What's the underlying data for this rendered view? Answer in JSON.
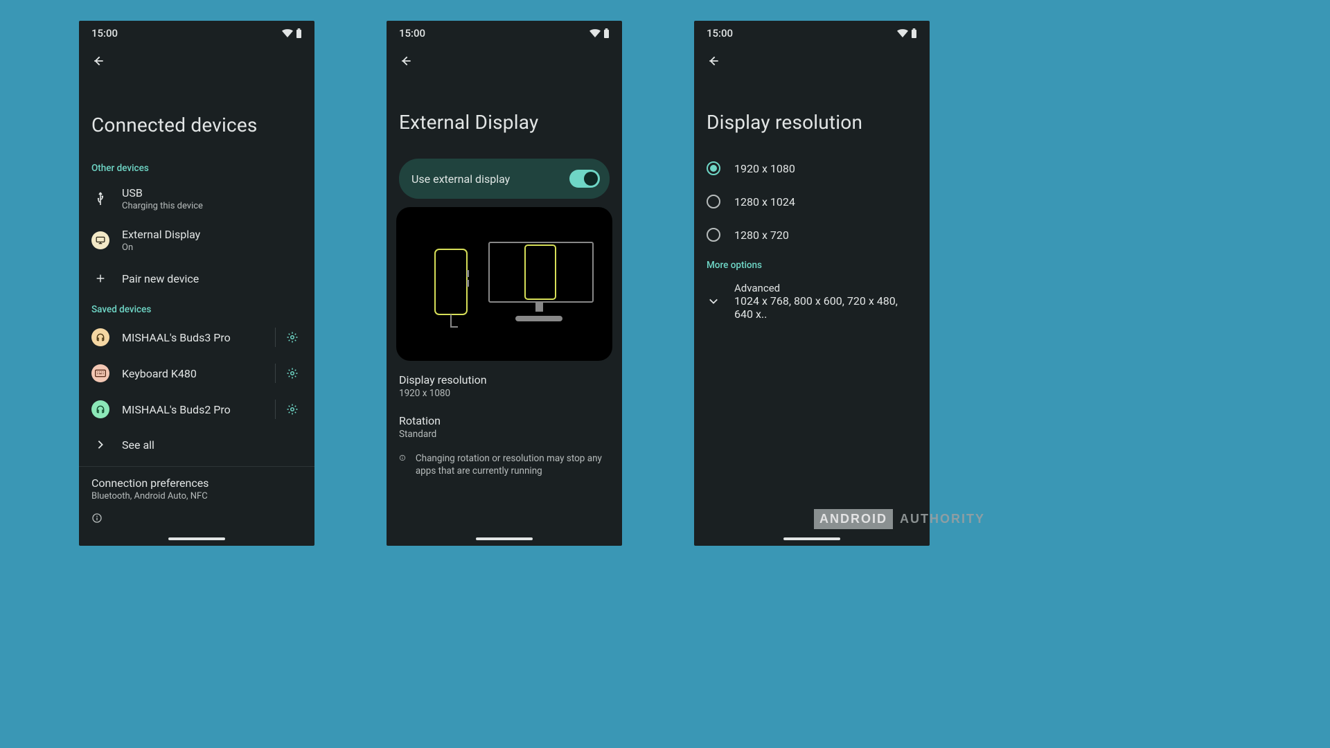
{
  "status": {
    "time": "15:00"
  },
  "watermark": {
    "brand": "ANDROID",
    "suffix": "AUTHORITY"
  },
  "screen1": {
    "title": "Connected devices",
    "section_other": "Other devices",
    "usb": {
      "title": "USB",
      "sub": "Charging this device"
    },
    "ext": {
      "title": "External Display",
      "sub": "On"
    },
    "pair": "Pair new device",
    "section_saved": "Saved devices",
    "saved": [
      {
        "name": "MISHAAL's Buds3 Pro"
      },
      {
        "name": "Keyboard K480"
      },
      {
        "name": "MISHAAL's Buds2 Pro"
      }
    ],
    "see_all": "See all",
    "conn_pref": {
      "title": "Connection preferences",
      "sub": "Bluetooth, Android Auto, NFC"
    }
  },
  "screen2": {
    "title": "External Display",
    "toggle_label": "Use external display",
    "toggle_on": true,
    "resolution": {
      "title": "Display resolution",
      "value": "1920 x 1080"
    },
    "rotation": {
      "title": "Rotation",
      "value": "Standard"
    },
    "info": "Changing rotation or resolution may stop any apps that are currently running"
  },
  "screen3": {
    "title": "Display resolution",
    "options": [
      {
        "label": "1920 x 1080",
        "selected": true
      },
      {
        "label": "1280 x 1024",
        "selected": false
      },
      {
        "label": "1280 x 720",
        "selected": false
      }
    ],
    "more_label": "More options",
    "advanced": {
      "title": "Advanced",
      "sub": "1024 x 768, 800 x 600, 720 x 480, 640 x.."
    }
  }
}
